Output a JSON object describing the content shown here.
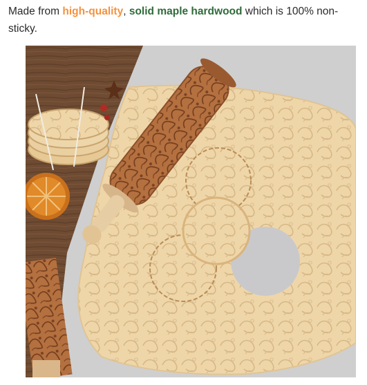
{
  "description": {
    "prefix": "Made from ",
    "highlight_1": "high-quality",
    "separator": ", ",
    "highlight_2": "solid maple hardwood",
    "suffix": " which is 100% non-sticky."
  },
  "colors": {
    "highlight_1": "#f5923e",
    "highlight_2": "#2f6b3a"
  },
  "image": {
    "subject": "embossed-rolling-pin-on-dough-photo"
  }
}
